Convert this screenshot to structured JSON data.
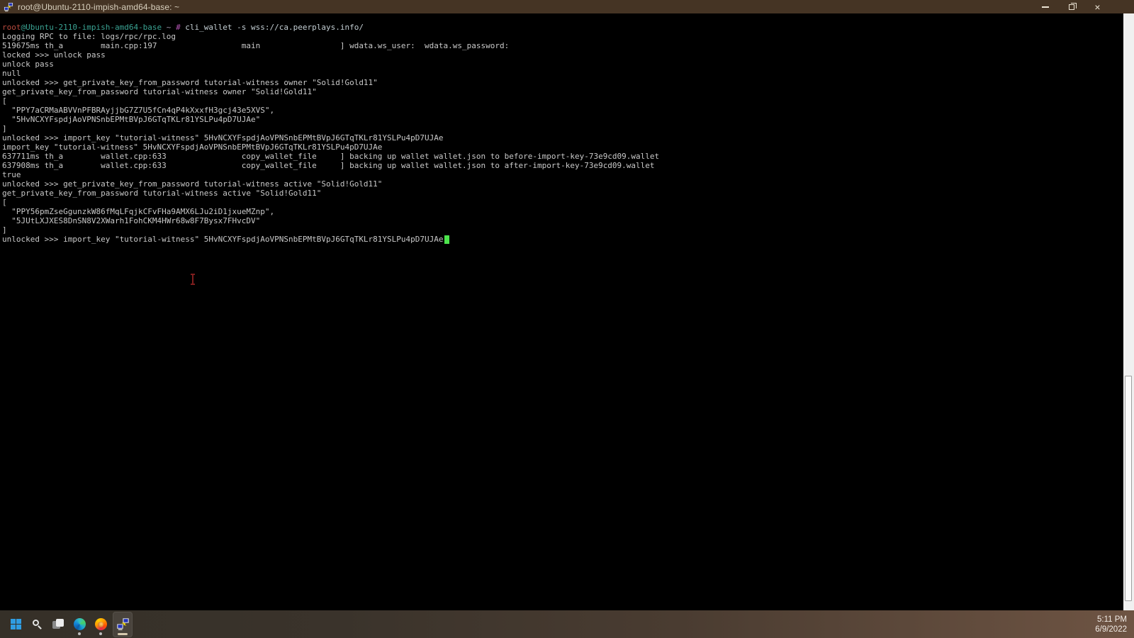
{
  "window": {
    "title": "root@Ubuntu-2110-impish-amd64-base: ~",
    "controls": {
      "close_glyph": "×"
    }
  },
  "terminal": {
    "colors": {
      "fg": "#c9c9c9",
      "red": "#b94a3e",
      "teal": "#3aa393",
      "punct": "#9d92a8",
      "hash": "#b455b4",
      "cmd": "#c4cfd4",
      "cursor": "#4ce44c"
    },
    "lines": [
      {
        "s": [
          [
            "root",
            "red"
          ],
          [
            "@Ubuntu-2110-impish-amd64-base",
            "teal"
          ],
          [
            " ~ ",
            "punct"
          ],
          [
            "#",
            "hash"
          ],
          [
            " cli_wallet -s wss://ca.peerplays.info/",
            "cmd"
          ]
        ]
      },
      {
        "s": [
          [
            "Logging RPC to file: logs/rpc/rpc.log",
            "fg"
          ]
        ]
      },
      {
        "s": [
          [
            "519675ms th_a        main.cpp:197                  main                 ] wdata.ws_user:  wdata.ws_password:",
            "fg"
          ]
        ]
      },
      {
        "s": [
          [
            "locked >>> unlock pass",
            "fg"
          ]
        ]
      },
      {
        "s": [
          [
            "unlock pass",
            "fg"
          ]
        ]
      },
      {
        "s": [
          [
            "null",
            "fg"
          ]
        ]
      },
      {
        "s": [
          [
            "unlocked >>> get_private_key_from_password tutorial-witness owner \"Solid!Gold11\"",
            "fg"
          ]
        ]
      },
      {
        "s": [
          [
            "get_private_key_from_password tutorial-witness owner \"Solid!Gold11\"",
            "fg"
          ]
        ]
      },
      {
        "s": [
          [
            "[",
            "fg"
          ]
        ]
      },
      {
        "s": [
          [
            "  \"PPY7aCRMaABVVnPFBRAyjjbG7Z7U5fCn4qP4kXxxfH3gcj43e5XVS\",",
            "fg"
          ]
        ]
      },
      {
        "s": [
          [
            "  \"5HvNCXYFspdjAoVPNSnbEPMtBVpJ6GTqTKLr81YSLPu4pD7UJAe\"",
            "fg"
          ]
        ]
      },
      {
        "s": [
          [
            "]",
            "fg"
          ]
        ]
      },
      {
        "s": [
          [
            "unlocked >>> import_key \"tutorial-witness\" 5HvNCXYFspdjAoVPNSnbEPMtBVpJ6GTqTKLr81YSLPu4pD7UJAe",
            "fg"
          ]
        ]
      },
      {
        "s": [
          [
            "import_key \"tutorial-witness\" 5HvNCXYFspdjAoVPNSnbEPMtBVpJ6GTqTKLr81YSLPu4pD7UJAe",
            "fg"
          ]
        ]
      },
      {
        "s": [
          [
            "637711ms th_a        wallet.cpp:633                copy_wallet_file     ] backing up wallet wallet.json to before-import-key-73e9cd09.wallet",
            "fg"
          ]
        ]
      },
      {
        "s": [
          [
            "637908ms th_a        wallet.cpp:633                copy_wallet_file     ] backing up wallet wallet.json to after-import-key-73e9cd09.wallet",
            "fg"
          ]
        ]
      },
      {
        "s": [
          [
            "true",
            "fg"
          ]
        ]
      },
      {
        "s": [
          [
            "unlocked >>> get_private_key_from_password tutorial-witness active \"Solid!Gold11\"",
            "fg"
          ]
        ]
      },
      {
        "s": [
          [
            "get_private_key_from_password tutorial-witness active \"Solid!Gold11\"",
            "fg"
          ]
        ]
      },
      {
        "s": [
          [
            "[",
            "fg"
          ]
        ]
      },
      {
        "s": [
          [
            "  \"PPY56pmZseGgunzkW86fMqLFqjkCFvFHa9AMX6LJu2iD1jxueMZnp\",",
            "fg"
          ]
        ]
      },
      {
        "s": [
          [
            "  \"5JUtLXJXES8DnSN8V2XWarh1FohCKM4HWr68w8F7Bysx7FHvcDV\"",
            "fg"
          ]
        ]
      },
      {
        "s": [
          [
            "]",
            "fg"
          ]
        ]
      },
      {
        "s": [
          [
            "unlocked >>> import_key \"tutorial-witness\" 5HvNCXYFspdjAoVPNSnbEPMtBVpJ6GTqTKLr81YSLPu4pD7UJAe",
            "fg"
          ]
        ],
        "cursor": true
      }
    ]
  },
  "taskbar": {
    "items": [
      {
        "name": "start"
      },
      {
        "name": "search"
      },
      {
        "name": "task-view"
      },
      {
        "name": "edge",
        "running": true
      },
      {
        "name": "firefox",
        "running": true
      },
      {
        "name": "putty",
        "running": true,
        "active": true
      }
    ],
    "clock": {
      "time": "5:11 PM",
      "date": "6/9/2022"
    }
  }
}
